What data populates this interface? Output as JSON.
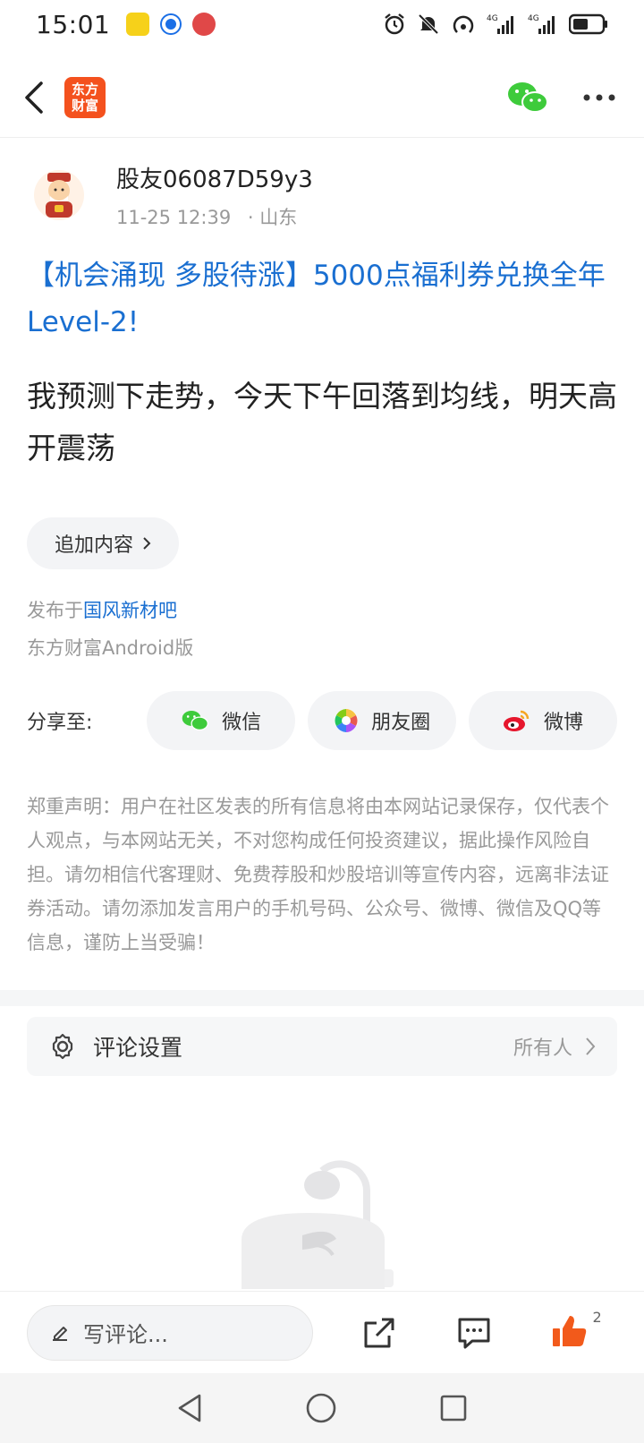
{
  "status_bar": {
    "time": "15:01",
    "signal1_label": "4G",
    "signal2_label": "4G",
    "sim_index": "1"
  },
  "nav": {
    "logo_line1": "东方",
    "logo_line2": "财富"
  },
  "post": {
    "author_name": "股友06087D59y3",
    "timestamp": "11-25 12:39",
    "location": "· 山东",
    "title": "【机会涌现 多股待涨】5000点福利券兑换全年Level-2!",
    "body": "我预测下走势，今天下午回落到均线，明天高开震荡",
    "append_label": "追加内容",
    "publish_prefix": "发布于",
    "bar_name": "国风新材吧",
    "client": "东方财富Android版"
  },
  "share": {
    "label": "分享至:",
    "wechat": "微信",
    "moments": "朋友圈",
    "weibo": "微博"
  },
  "disclaimer": "郑重声明：用户在社区发表的所有信息将由本网站记录保存，仅代表个人观点，与本网站无关，不对您构成任何投资建议，据此操作风险自担。请勿相信代客理财、免费荐股和炒股培训等宣传内容，远离非法证券活动。请勿添加发言用户的手机号码、公众号、微博、微信及QQ等信息，谨防上当受骗！",
  "comment_settings": {
    "label": "评论设置",
    "value": "所有人"
  },
  "bottom_bar": {
    "comment_placeholder": "写评论...",
    "like_count": "2"
  },
  "colors": {
    "link_blue": "#1a6fd1",
    "brand_orange": "#f4511e",
    "like_orange": "#f25a1b"
  }
}
